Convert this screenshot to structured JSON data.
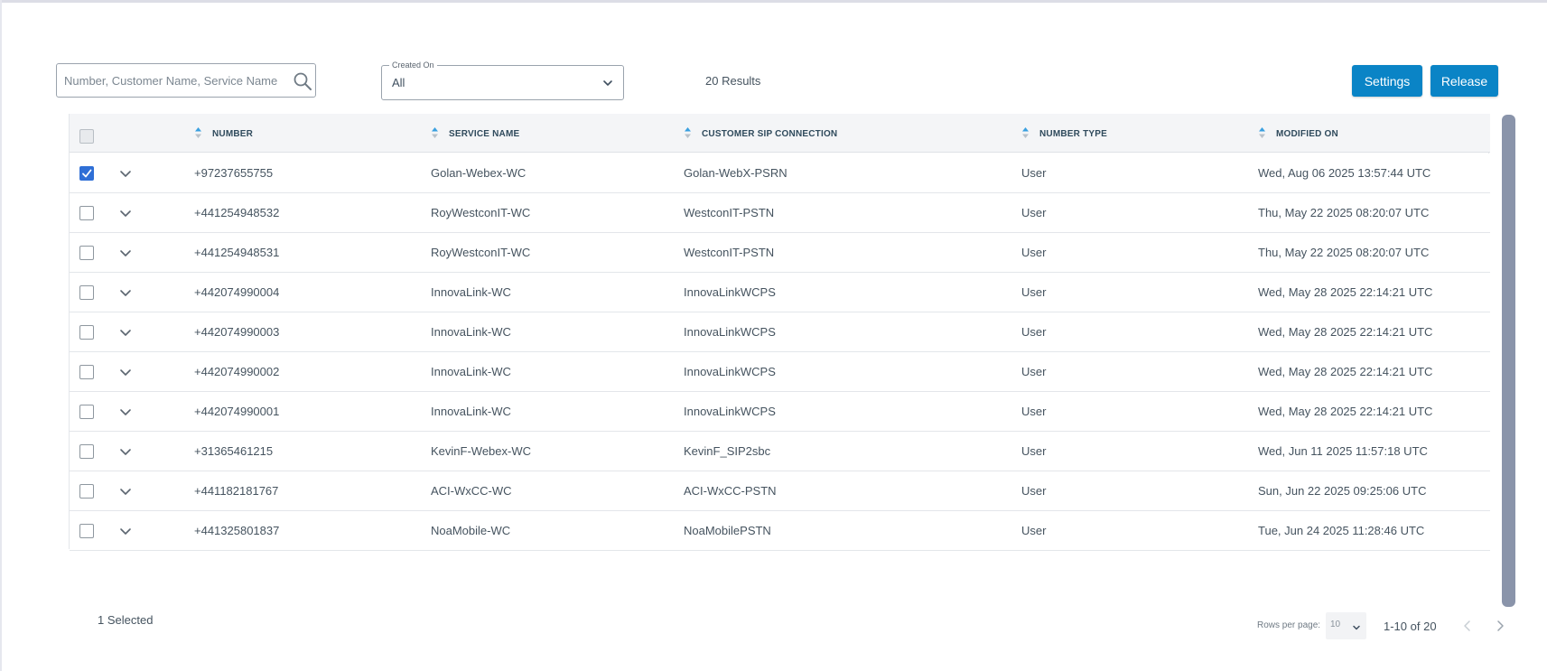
{
  "toolbar": {
    "search_placeholder": "Number, Customer Name, Service Name",
    "filter_label": "Created On",
    "filter_value": "All",
    "results_text": "20 Results",
    "settings_label": "Settings",
    "release_label": "Release"
  },
  "table": {
    "columns": [
      "NUMBER",
      "SERVICE NAME",
      "CUSTOMER SIP CONNECTION",
      "NUMBER TYPE",
      "MODIFIED ON"
    ],
    "rows": [
      {
        "checked": true,
        "number": "+97237655755",
        "service": "Golan-Webex-WC",
        "sip": "Golan-WebX-PSRN",
        "type": "User",
        "modified": "Wed, Aug 06 2025 13:57:44 UTC"
      },
      {
        "checked": false,
        "number": "+441254948532",
        "service": "RoyWestconIT-WC",
        "sip": "WestconIT-PSTN",
        "type": "User",
        "modified": "Thu, May 22 2025 08:20:07 UTC"
      },
      {
        "checked": false,
        "number": "+441254948531",
        "service": "RoyWestconIT-WC",
        "sip": "WestconIT-PSTN",
        "type": "User",
        "modified": "Thu, May 22 2025 08:20:07 UTC"
      },
      {
        "checked": false,
        "number": "+442074990004",
        "service": "InnovaLink-WC",
        "sip": "InnovaLinkWCPS",
        "type": "User",
        "modified": "Wed, May 28 2025 22:14:21 UTC"
      },
      {
        "checked": false,
        "number": "+442074990003",
        "service": "InnovaLink-WC",
        "sip": "InnovaLinkWCPS",
        "type": "User",
        "modified": "Wed, May 28 2025 22:14:21 UTC"
      },
      {
        "checked": false,
        "number": "+442074990002",
        "service": "InnovaLink-WC",
        "sip": "InnovaLinkWCPS",
        "type": "User",
        "modified": "Wed, May 28 2025 22:14:21 UTC"
      },
      {
        "checked": false,
        "number": "+442074990001",
        "service": "InnovaLink-WC",
        "sip": "InnovaLinkWCPS",
        "type": "User",
        "modified": "Wed, May 28 2025 22:14:21 UTC"
      },
      {
        "checked": false,
        "number": "+31365461215",
        "service": "KevinF-Webex-WC",
        "sip": "KevinF_SIP2sbc",
        "type": "User",
        "modified": "Wed, Jun 11 2025 11:57:18 UTC"
      },
      {
        "checked": false,
        "number": "+441182181767",
        "service": "ACI-WxCC-WC",
        "sip": "ACI-WxCC-PSTN",
        "type": "User",
        "modified": "Sun, Jun 22 2025 09:25:06 UTC"
      },
      {
        "checked": false,
        "number": "+441325801837",
        "service": "NoaMobile-WC",
        "sip": "NoaMobilePSTN",
        "type": "User",
        "modified": "Tue, Jun 24 2025 11:28:46 UTC"
      }
    ]
  },
  "footer": {
    "selected_text": "1 Selected",
    "rows_per_page_label": "Rows per page:",
    "rows_per_page_value": "10",
    "range_text": "1-10 of 20"
  },
  "colors": {
    "accent": "#0a84c6",
    "checkbox_checked": "#2f6fd6",
    "header_bg": "#f4f5f7",
    "scrollbar": "#8a94aa"
  },
  "icons": [
    "search-icon",
    "chevron-down-icon",
    "sort-icon",
    "expand-chevron-icon",
    "check-icon",
    "chevron-left-icon",
    "chevron-right-icon"
  ]
}
